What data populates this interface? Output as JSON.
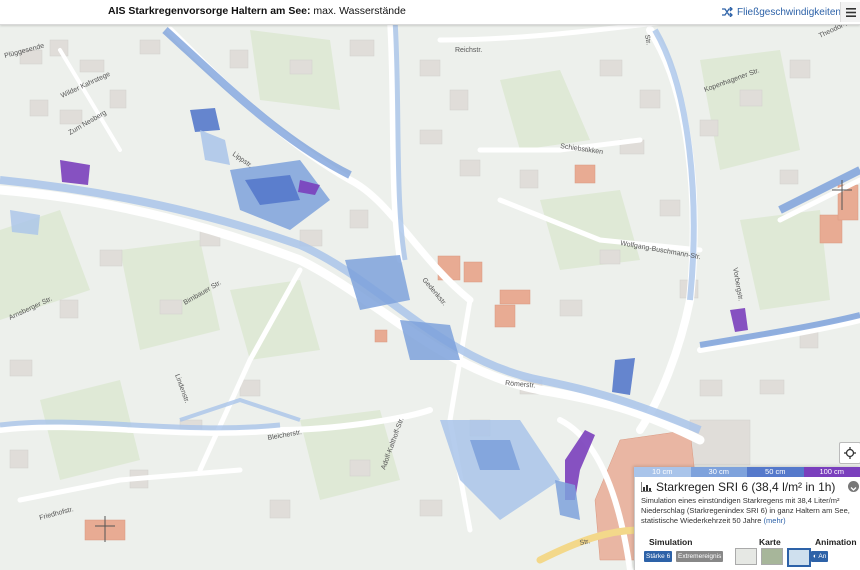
{
  "header": {
    "title_bold": "AIS Starkregenvorsorge Haltern am See:",
    "title_rest": " max. Wasserstände",
    "flow_button_label": "Fließgeschwindigkeiten"
  },
  "map": {
    "street_labels": [
      "Plüggesende",
      "Wilder Kahrstege",
      "Zum Nesberg",
      "Reichstr.",
      "Lippstr.",
      "Schiebstikken",
      "Wolfgang-Buschmann-Str.",
      "Kopenhagener Str.",
      "Vorbergstr.",
      "Theodor-Heuss-Str.",
      "Arnsberger Str.",
      "Bimbauer Str.",
      "Lindenstr.",
      "Römerstr.",
      "Adolf-Kalthoff-Str.",
      "Bleicherstr.",
      "Gedenkstr.",
      "Friedhofstr.",
      "Str.",
      "Str."
    ]
  },
  "legend": {
    "items": [
      {
        "label": "10 cm",
        "color": "#a9c4ea"
      },
      {
        "label": "30 cm",
        "color": "#7ea2dc"
      },
      {
        "label": "50 cm",
        "color": "#5579cb"
      },
      {
        "label": "100 cm",
        "color": "#7a3fbd"
      }
    ]
  },
  "panel": {
    "chart_icon": "bar-chart-icon",
    "title": "Starkregen SRI 6 (38,4 l/m² in 1h)",
    "description": "Simulation eines einstündigen Starkregens mit 38,4 Liter/m² Niederschlag (Starkregenindex SRI 6) in ganz Haltern am See, statistische Wiederkehrzeit 50 Jahre",
    "more_link": "(mehr)",
    "simulation_label": "Simulation",
    "karte_label": "Karte",
    "animation_label": "Animation",
    "chip_staerke": "Stärke 6",
    "chip_extrem": "Extremereignis",
    "chip_animation": "◐ An"
  },
  "colors": {
    "accent": "#2d62a8",
    "water_light": "#a9c4ea",
    "water_mid": "#7ea2dc",
    "water_deep": "#5579cb",
    "water_extreme": "#7a3fbd",
    "building": "#e2dfdb",
    "public_building": "#e7a890"
  }
}
